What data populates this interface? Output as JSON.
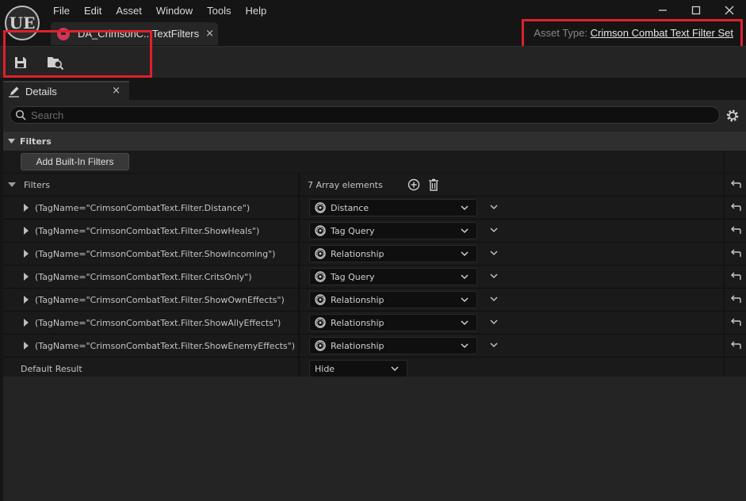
{
  "app": {
    "logo": "UE"
  },
  "menu": [
    "File",
    "Edit",
    "Asset",
    "Window",
    "Tools",
    "Help"
  ],
  "window_controls": {
    "minimize": "—",
    "maximize": "☐",
    "close": "✕"
  },
  "asset_tab": {
    "label": "DA_CrimsonC...TextFilters",
    "close": "×",
    "icon": "data-asset-icon"
  },
  "asset_type": {
    "label": "Asset Type:",
    "value": "Crimson Combat Text Filter Set"
  },
  "toolbar": {
    "icons": [
      "save-icon",
      "browse-icon"
    ]
  },
  "details_tab": {
    "label": "Details",
    "close": "×"
  },
  "search": {
    "placeholder": "Search",
    "value": ""
  },
  "category": {
    "label": "Filters"
  },
  "builtin_button": {
    "label": "Add Built-In Filters"
  },
  "filters_array": {
    "label": "Filters",
    "count_text": "7 Array elements"
  },
  "filters": [
    {
      "name": "(TagName=\"CrimsonCombatText.Filter.Distance\")",
      "type": "Distance"
    },
    {
      "name": "(TagName=\"CrimsonCombatText.Filter.ShowHeals\")",
      "type": "Tag Query"
    },
    {
      "name": "(TagName=\"CrimsonCombatText.Filter.ShowIncoming\")",
      "type": "Relationship"
    },
    {
      "name": "(TagName=\"CrimsonCombatText.Filter.CritsOnly\")",
      "type": "Tag Query"
    },
    {
      "name": "(TagName=\"CrimsonCombatText.Filter.ShowOwnEffects\")",
      "type": "Relationship"
    },
    {
      "name": "(TagName=\"CrimsonCombatText.Filter.ShowAllyEffects\")",
      "type": "Relationship"
    },
    {
      "name": "(TagName=\"CrimsonCombatText.Filter.ShowEnemyEffects\")",
      "type": "Relationship"
    }
  ],
  "default_result": {
    "label": "Default Result",
    "value": "Hide"
  },
  "colors": {
    "accent_red": "#e0202a",
    "asset_icon": "#d1365a",
    "panel_bg": "#242424",
    "row_bg": "#1a1a1a"
  }
}
